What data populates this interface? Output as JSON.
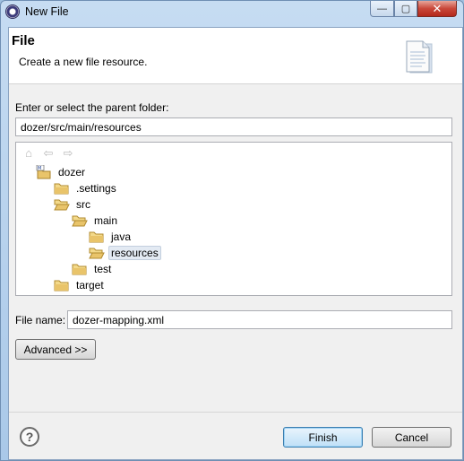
{
  "window": {
    "title": "New File",
    "close_glyph": "✕",
    "minimize_glyph": "—",
    "maximize_glyph": "▢"
  },
  "banner": {
    "title": "File",
    "message": "Create a new file resource.",
    "icon": "new-file-document-icon"
  },
  "parent_folder": {
    "label": "Enter or select the parent folder:",
    "value": "dozer/src/main/resources"
  },
  "tree": {
    "nav_icons": [
      "home-icon",
      "back-icon",
      "forward-icon"
    ],
    "nodes": [
      {
        "label": "dozer",
        "icon": "project-icon",
        "depth": 0
      },
      {
        "label": ".settings",
        "icon": "folder-icon",
        "depth": 1
      },
      {
        "label": "src",
        "icon": "folder-open-icon",
        "depth": 1
      },
      {
        "label": "main",
        "icon": "folder-open-icon",
        "depth": 2
      },
      {
        "label": "java",
        "icon": "folder-icon",
        "depth": 3
      },
      {
        "label": "resources",
        "icon": "folder-open-icon",
        "depth": 3,
        "selected": true
      },
      {
        "label": "test",
        "icon": "folder-icon",
        "depth": 2
      },
      {
        "label": "target",
        "icon": "folder-icon",
        "depth": 1
      }
    ]
  },
  "file_name": {
    "label": "File name:",
    "value": "dozer-mapping.xml"
  },
  "buttons": {
    "advanced": "Advanced >>",
    "finish": "Finish",
    "cancel": "Cancel",
    "help": "?"
  },
  "colors": {
    "folder": "#e9c46a",
    "selection": "#e3eaf3",
    "default_button_border": "#3c7fb1"
  }
}
